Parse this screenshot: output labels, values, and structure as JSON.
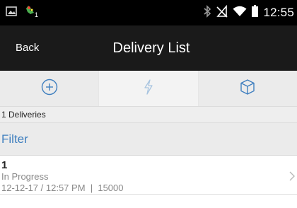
{
  "status_bar": {
    "time": "12:55",
    "notification_badge": "1",
    "icons": [
      "image-icon",
      "app-notification-icon",
      "bluetooth-icon",
      "no-signal-icon",
      "wifi-icon",
      "battery-icon"
    ]
  },
  "header": {
    "back_label": "Back",
    "title": "Delivery List"
  },
  "toolbar": {
    "buttons": [
      {
        "icon": "add-icon",
        "accent_color": "#3f7fbf"
      },
      {
        "icon": "flash-icon",
        "accent_color": "#a8c4e0"
      },
      {
        "icon": "package-icon",
        "accent_color": "#3f7fbf"
      }
    ]
  },
  "list": {
    "count_label": "1 Deliveries",
    "filter_label": "Filter",
    "items": [
      {
        "id": "1",
        "status": "In Progress",
        "meta": "12-12-17 / 12:57 PM  |  15000"
      }
    ]
  },
  "colors": {
    "accent": "#3f7fbf",
    "status_bar": "#000000",
    "action_bar": "#1a1a1a"
  }
}
